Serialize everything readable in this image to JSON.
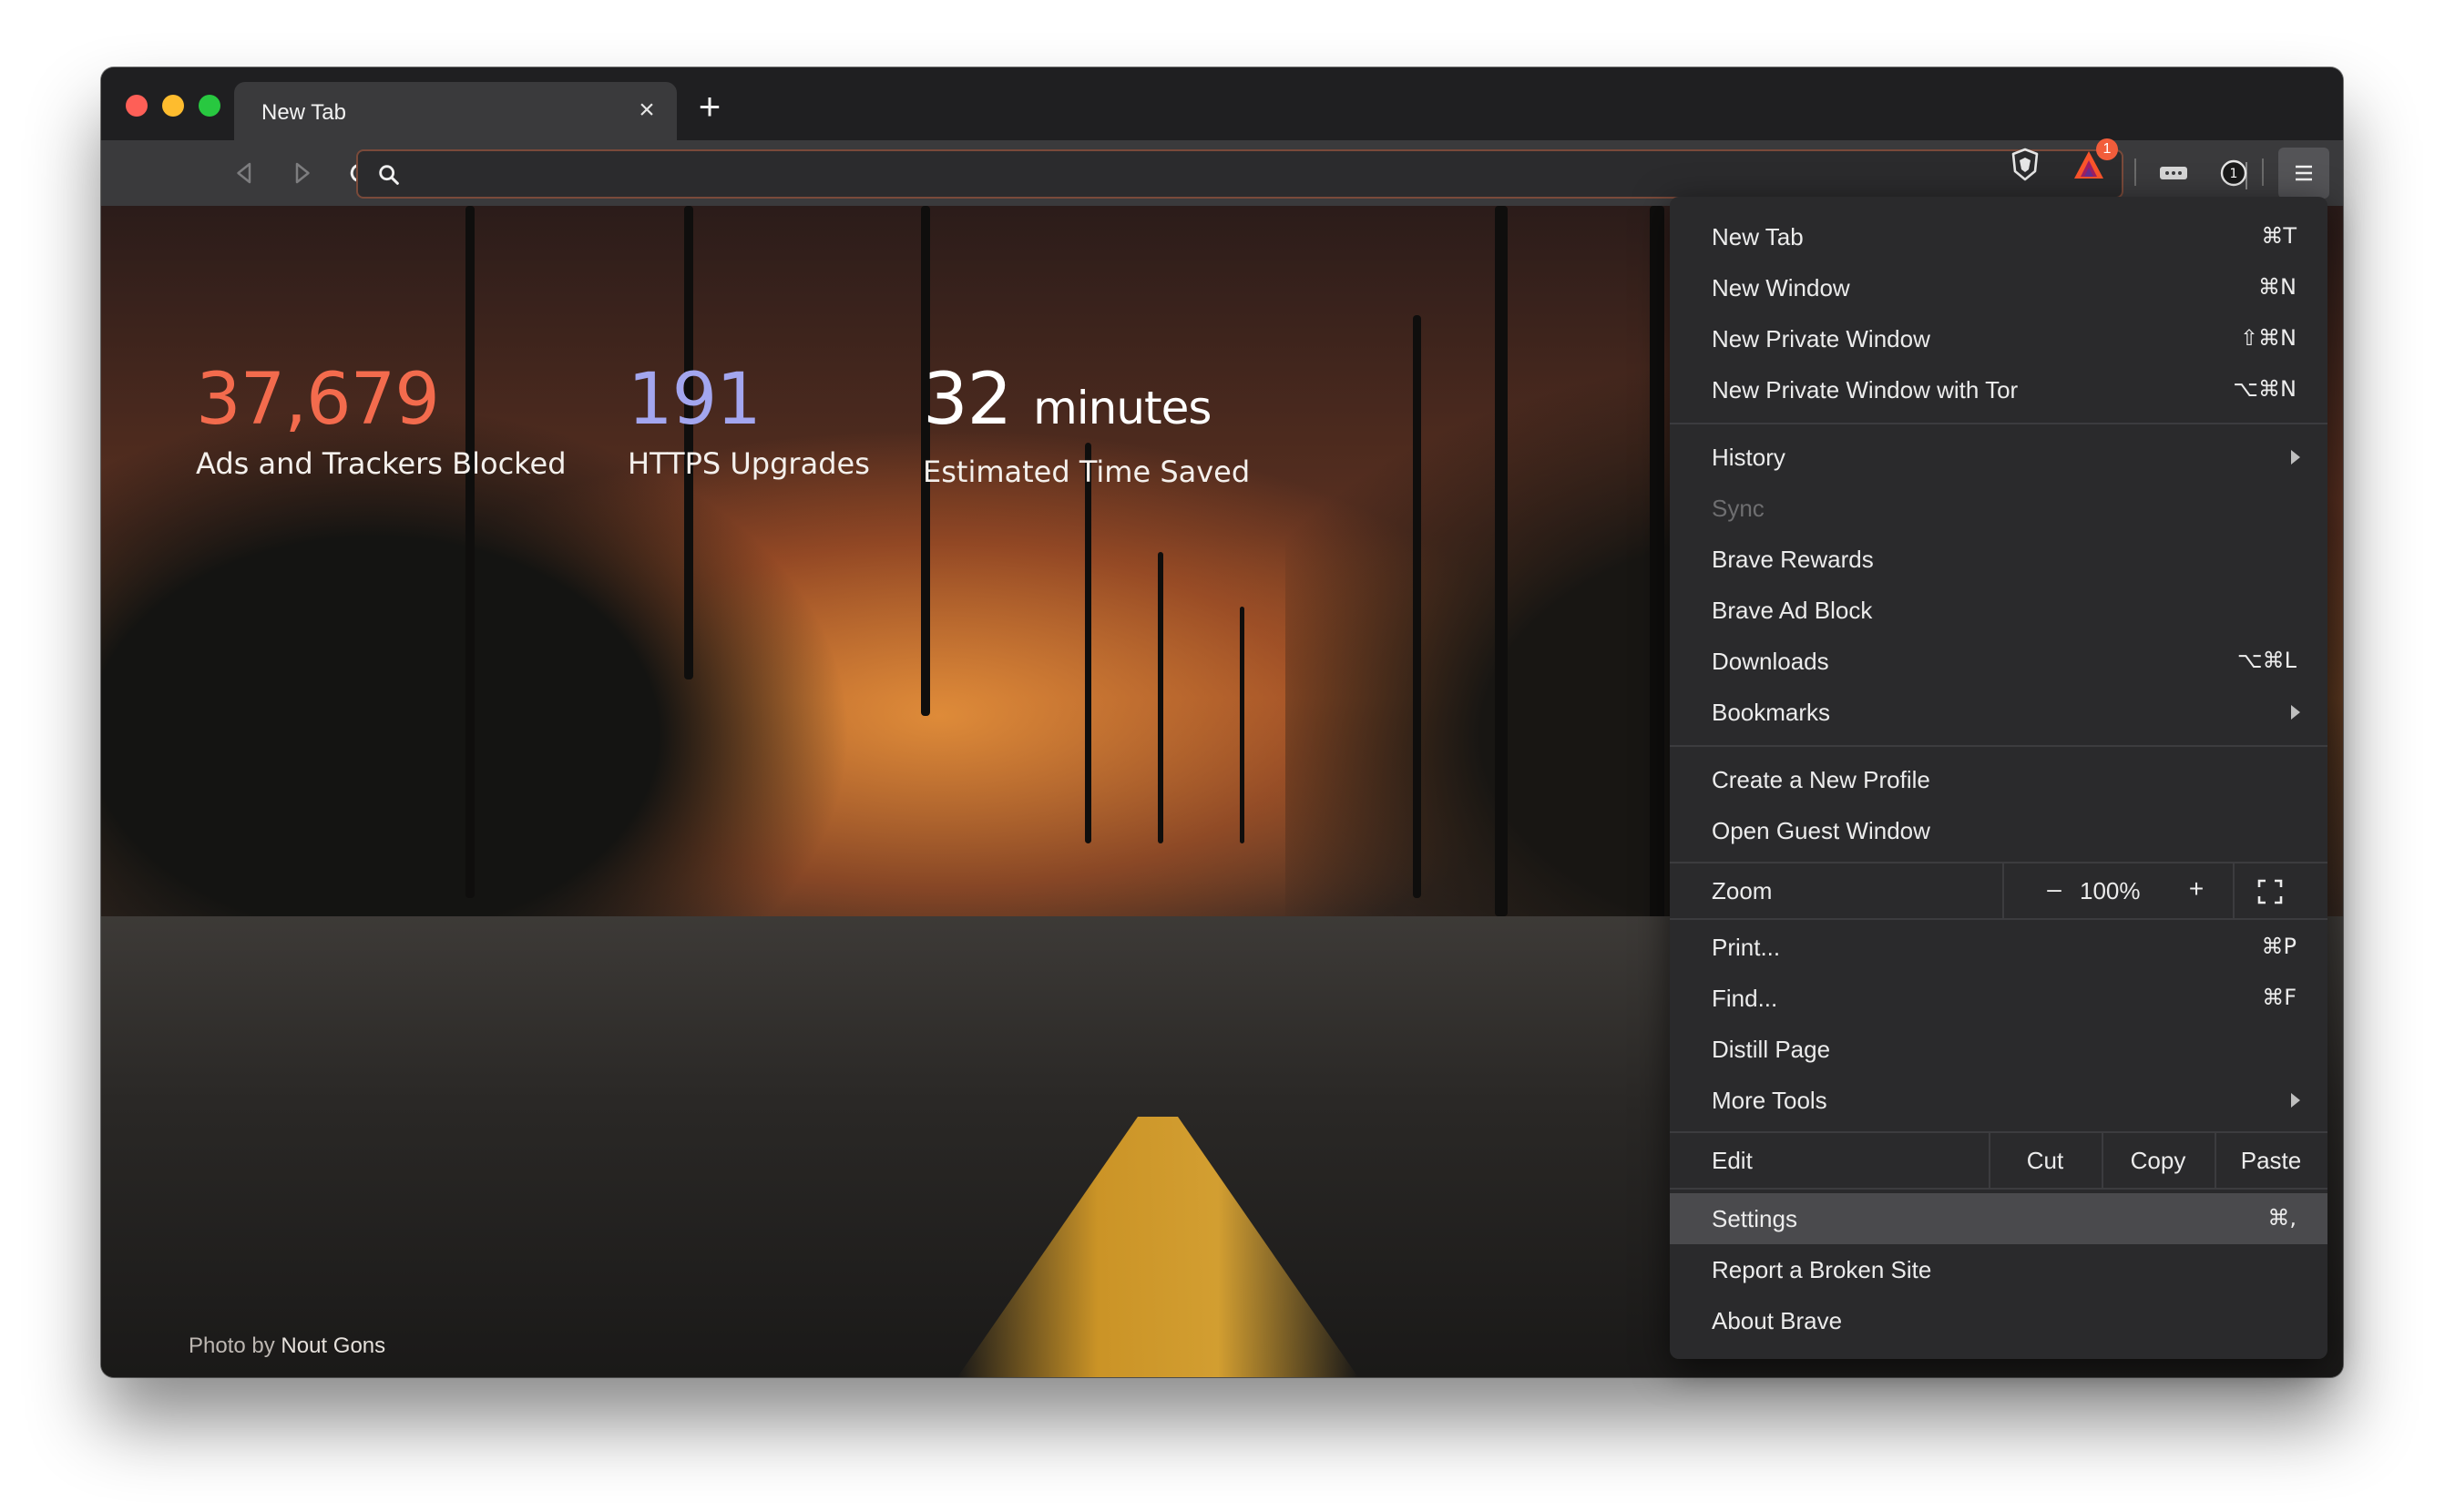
{
  "window": {
    "tab_title": "New Tab",
    "tab_close": "×",
    "new_tab": "+"
  },
  "toolbar": {
    "url_placeholder": "",
    "rewards_badge": "1",
    "ext_password_count": "1"
  },
  "stats": [
    {
      "value": "37,679",
      "label": "Ads and Trackers Blocked",
      "color": "#f36b4d"
    },
    {
      "value": "191",
      "label": "HTTPS Upgrades",
      "color": "#a3a6ef"
    },
    {
      "value": "32",
      "unit": "minutes",
      "label": "Estimated Time Saved",
      "color": "#ffffff"
    }
  ],
  "photo_credit": {
    "prefix": "Photo by",
    "author": "Nout Gons"
  },
  "menu": {
    "new_tab": {
      "label": "New Tab",
      "shortcut": "⌘T"
    },
    "new_window": {
      "label": "New Window",
      "shortcut": "⌘N"
    },
    "new_private_window": {
      "label": "New Private Window",
      "shortcut": "⇧⌘N"
    },
    "new_private_tor": {
      "label": "New Private Window with Tor",
      "shortcut": "⌥⌘N"
    },
    "history": {
      "label": "History"
    },
    "sync": {
      "label": "Sync"
    },
    "brave_rewards": {
      "label": "Brave Rewards"
    },
    "brave_ad_block": {
      "label": "Brave Ad Block"
    },
    "downloads": {
      "label": "Downloads",
      "shortcut": "⌥⌘L"
    },
    "bookmarks": {
      "label": "Bookmarks"
    },
    "create_profile": {
      "label": "Create a New Profile"
    },
    "guest_window": {
      "label": "Open Guest Window"
    },
    "zoom": {
      "label": "Zoom",
      "minus": "–",
      "value": "100%",
      "plus": "+"
    },
    "print": {
      "label": "Print...",
      "shortcut": "⌘P"
    },
    "find": {
      "label": "Find...",
      "shortcut": "⌘F"
    },
    "distill": {
      "label": "Distill Page"
    },
    "more_tools": {
      "label": "More Tools"
    },
    "edit": {
      "label": "Edit",
      "cut": "Cut",
      "copy": "Copy",
      "paste": "Paste"
    },
    "settings": {
      "label": "Settings",
      "shortcut": "⌘,"
    },
    "report_broken": {
      "label": "Report a Broken Site"
    },
    "about": {
      "label": "About Brave"
    }
  }
}
